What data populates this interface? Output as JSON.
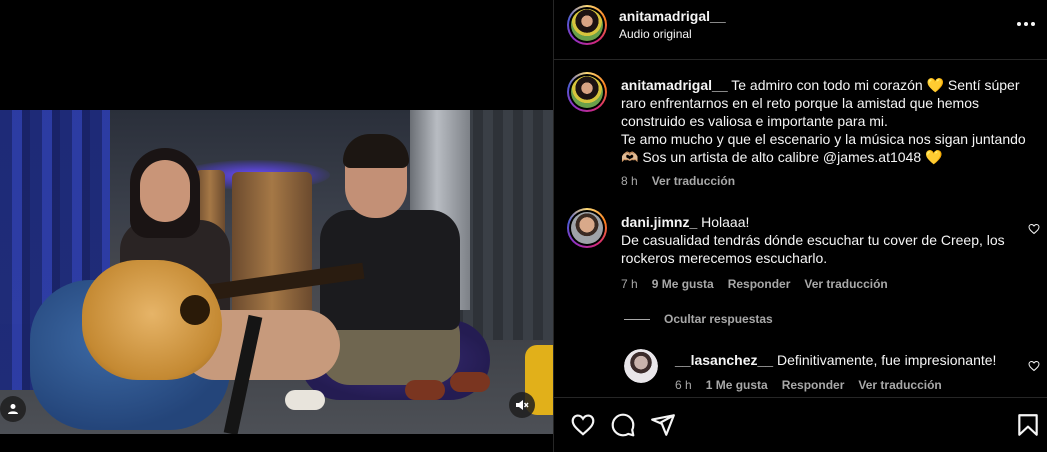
{
  "post": {
    "author": "anitamadrigal__",
    "audio_label": "Audio original"
  },
  "comments": [
    {
      "username": "anitamadrigal__",
      "lines": [
        "Te admiro con todo mi corazón 💛 Sentí súper",
        "raro enfrentarnos en el reto porque la amistad que hemos",
        "construido es valiosa e importante para mi.",
        "Te amo mucho y que el escenario y la música nos sigan juntando",
        "🫶🏼 Sos un artista de alto calibre @james.at1048 💛"
      ],
      "time": "8 h",
      "translate": "Ver traducción"
    },
    {
      "username": "dani.jimnz_",
      "lines": [
        "Holaaa!",
        "De casualidad tendrás dónde escuchar tu cover de Creep, los",
        "rockeros merecemos escucharlo."
      ],
      "time": "7 h",
      "likes": "9 Me gusta",
      "reply": "Responder",
      "translate": "Ver traducción"
    }
  ],
  "hide_replies_label": "Ocultar respuestas",
  "reply": {
    "username": "__lasanchez__",
    "text": "Definitivamente, fue impresionante!",
    "time": "6 h",
    "likes": "1 Me gusta",
    "reply": "Responder",
    "translate": "Ver traducción"
  },
  "icons": {
    "like": "heart-icon",
    "comment": "comment-icon",
    "share": "send-icon",
    "save": "bookmark-icon",
    "more": "more-options-icon",
    "mute": "muted-speaker-icon",
    "tagged_users": "user-icon"
  }
}
